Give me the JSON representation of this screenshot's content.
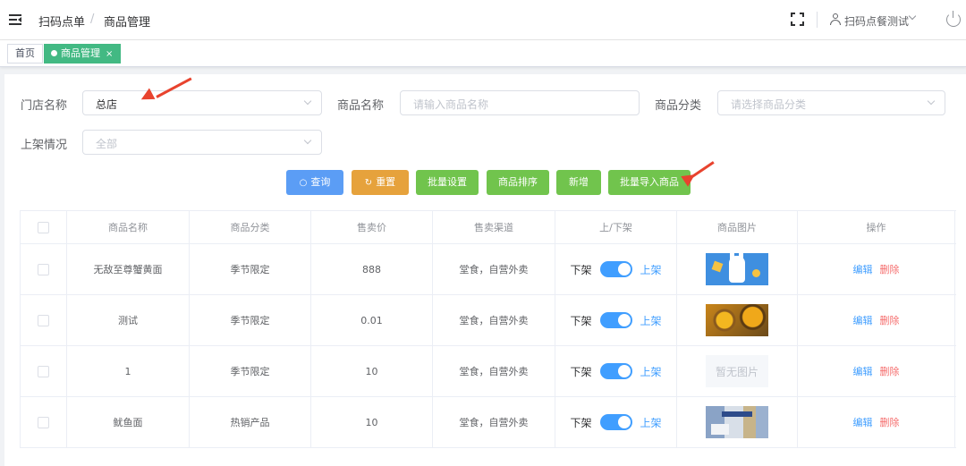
{
  "header": {
    "breadcrumb": [
      "扫码点单",
      "商品管理"
    ],
    "breadcrumb_sep": "/",
    "user_name": "扫码点餐测试"
  },
  "tags": {
    "home": "首页",
    "active": "商品管理",
    "close": "×"
  },
  "filters": {
    "store_label": "门店名称",
    "store_value": "总店",
    "name_label": "商品名称",
    "name_placeholder": "请输入商品名称",
    "category_label": "商品分类",
    "category_placeholder": "请选择商品分类",
    "shelf_label": "上架情况",
    "shelf_placeholder": "全部"
  },
  "buttons": {
    "search": "查询",
    "reset": "重置",
    "batch_settings": "批量设置",
    "sort": "商品排序",
    "add": "新增",
    "batch_import": "批量导入商品"
  },
  "table": {
    "columns": [
      "商品名称",
      "商品分类",
      "售卖价",
      "售卖渠道",
      "上/下架",
      "商品图片",
      "操作"
    ],
    "rows": [
      {
        "name": "无敌至尊蟹黄面",
        "category": "季节限定",
        "price": "888",
        "channel": "堂食，自营外卖",
        "image": "bunny"
      },
      {
        "name": "测试",
        "category": "季节限定",
        "price": "0.01",
        "channel": "堂食，自营外卖",
        "image": "flower"
      },
      {
        "name": "1",
        "category": "季节限定",
        "price": "10",
        "channel": "堂食，自营外卖",
        "image": "none"
      },
      {
        "name": "鱿鱼面",
        "category": "热销产品",
        "price": "10",
        "channel": "堂食，自营外卖",
        "image": "mix"
      }
    ],
    "shelf_off": "下架",
    "shelf_on": "上架",
    "no_image": "暂无图片",
    "edit": "编辑",
    "delete": "删除"
  },
  "colors": {
    "primary": "#409eff",
    "success": "#71c44d",
    "warning": "#e6a23c",
    "danger": "#f56c6c",
    "tag_active": "#42b983",
    "annotation_arrow": "#e8432e"
  }
}
